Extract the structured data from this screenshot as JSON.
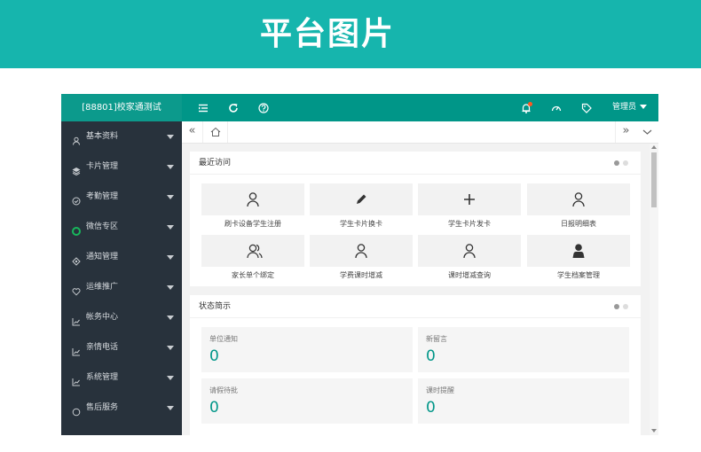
{
  "banner": {
    "title": "平台图片"
  },
  "app": {
    "brand": "[88801]校家通测试",
    "user_menu": "管理员",
    "colors": {
      "accent": "#009688",
      "sidebar": "#28323c",
      "notify_dot": "#ff5722",
      "active_icon": "#18b75c"
    }
  },
  "sidebar": {
    "items": [
      {
        "label": "基本资料",
        "icon": "user-icon"
      },
      {
        "label": "卡片管理",
        "icon": "layers-icon"
      },
      {
        "label": "考勤管理",
        "icon": "check-circle-icon"
      },
      {
        "label": "微信专区",
        "icon": "wechat-icon"
      },
      {
        "label": "通知管理",
        "icon": "diamond-icon"
      },
      {
        "label": "运维推广",
        "icon": "heart-icon"
      },
      {
        "label": "帐务中心",
        "icon": "chart-icon"
      },
      {
        "label": "亲情电话",
        "icon": "chart-icon"
      },
      {
        "label": "系统管理",
        "icon": "chart-icon"
      },
      {
        "label": "售后服务",
        "icon": "circle-icon"
      }
    ]
  },
  "tabs": {
    "prev": "«",
    "next": "»"
  },
  "recent": {
    "title": "最近访问",
    "items": [
      {
        "label": "刷卡设备学生注册",
        "icon": "user-outline-icon"
      },
      {
        "label": "学生卡片换卡",
        "icon": "pencil-icon"
      },
      {
        "label": "学生卡片发卡",
        "icon": "plus-icon"
      },
      {
        "label": "日报明细表",
        "icon": "user-outline-icon"
      },
      {
        "label": "家长单个绑定",
        "icon": "users-outline-icon"
      },
      {
        "label": "学费课时增减",
        "icon": "user-outline-icon"
      },
      {
        "label": "课时增减查询",
        "icon": "user-outline-icon"
      },
      {
        "label": "学生档案管理",
        "icon": "user-solid-icon"
      }
    ]
  },
  "status": {
    "title": "状态简示",
    "items": [
      {
        "label": "单位通知",
        "value": "0"
      },
      {
        "label": "新留言",
        "value": "0"
      },
      {
        "label": "请假待批",
        "value": "0"
      },
      {
        "label": "课时提醒",
        "value": "0"
      }
    ]
  }
}
